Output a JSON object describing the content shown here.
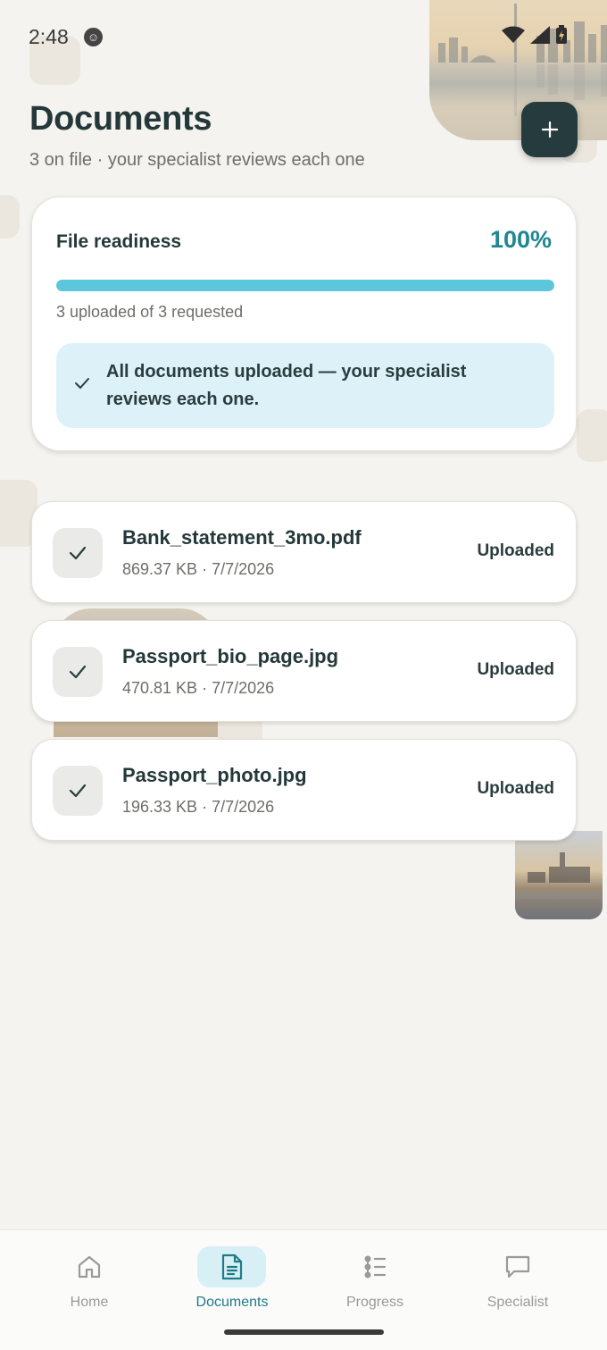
{
  "status_bar": {
    "time": "2:48"
  },
  "header": {
    "title": "Documents",
    "subtitle": "3 on file · your specialist reviews each one",
    "add_button_label": "+"
  },
  "readiness": {
    "title": "File readiness",
    "percent_text": "100%",
    "progress_fraction": 1.0,
    "count_text": "3 uploaded of 3 requested",
    "notice": "All documents uploaded — your specialist reviews each one."
  },
  "documents": [
    {
      "name": "Bank_statement_3mo.pdf",
      "meta": "869.37 KB · 7/7/2026",
      "status": "Uploaded"
    },
    {
      "name": "Passport_bio_page.jpg",
      "meta": "470.81 KB · 7/7/2026",
      "status": "Uploaded"
    },
    {
      "name": "Passport_photo.jpg",
      "meta": "196.33 KB · 7/7/2026",
      "status": "Uploaded"
    }
  ],
  "nav": {
    "items": [
      {
        "label": "Home",
        "icon": "home-icon",
        "active": false
      },
      {
        "label": "Documents",
        "icon": "document-icon",
        "active": true
      },
      {
        "label": "Progress",
        "icon": "progress-list-icon",
        "active": false
      },
      {
        "label": "Specialist",
        "icon": "chat-icon",
        "active": false
      }
    ]
  },
  "colors": {
    "accent": "#1e8790",
    "progress_fill": "#5bc6dc",
    "notice_bg": "#ddf2f8",
    "fab_bg": "#263b3d",
    "page_bg": "#f5f3ef"
  }
}
